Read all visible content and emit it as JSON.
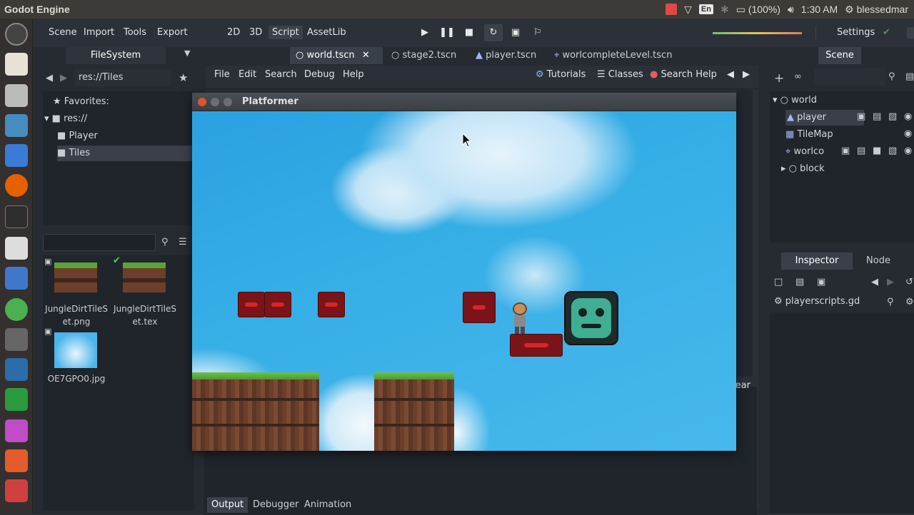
{
  "os": {
    "window_title": "Godot Engine",
    "lang": "En",
    "battery": "(100%)",
    "time": "1:30 AM",
    "user": "blessedmar"
  },
  "godot": {
    "menu": [
      "Scene",
      "Import",
      "Tools",
      "Export"
    ],
    "modes": [
      "2D",
      "3D",
      "Script",
      "AssetLib"
    ],
    "active_mode": "Script",
    "settings_label": "Settings",
    "scene_tabs": [
      {
        "label": "world.tscn",
        "icon": "node-circle-icon",
        "closable": true
      },
      {
        "label": "stage2.tscn",
        "icon": "node-circle-icon"
      },
      {
        "label": "player.tscn",
        "icon": "sprite-icon"
      },
      {
        "label": "worlcompleteLevel.tscn",
        "icon": "node2d-icon"
      }
    ],
    "filesystem": {
      "title": "FileSystem",
      "path": "res://Tiles",
      "favorites_label": "Favorites:",
      "tree": [
        {
          "label": "res://",
          "level": 0
        },
        {
          "label": "Player",
          "level": 1
        },
        {
          "label": "Tiles",
          "level": 1,
          "selected": true
        }
      ],
      "files": [
        {
          "name": "JungleDirtTileSet.png",
          "line1": "JungleDirtTileS",
          "line2": "et.png"
        },
        {
          "name": "JungleDirtTileSet.tex",
          "line1": "JungleDirtTileS",
          "line2": "et.tex"
        },
        {
          "name": "OE7GPO0.jpg",
          "line1": "OE7GPO0.jpg"
        }
      ]
    },
    "script_menu": [
      "File",
      "Edit",
      "Search",
      "Debug",
      "Help"
    ],
    "script_tools": [
      "Tutorials",
      "Classes",
      "Search Help"
    ],
    "scene_panel": {
      "title": "Scene",
      "tree": [
        {
          "label": "world",
          "level": 0
        },
        {
          "label": "player",
          "level": 1,
          "selected": true
        },
        {
          "label": "TileMap",
          "level": 1
        },
        {
          "label": "worlco",
          "level": 1
        },
        {
          "label": "block",
          "level": 0
        }
      ]
    },
    "inspector": {
      "tabs": [
        "Inspector",
        "Node"
      ],
      "active_tab": "Inspector",
      "resource": "playerscripts.gd"
    },
    "bottom_tabs": [
      "Output",
      "Debugger",
      "Animation"
    ],
    "active_bottom_tab": "Output",
    "clear_label": "lear"
  },
  "game_window": {
    "title": "Platformer"
  }
}
